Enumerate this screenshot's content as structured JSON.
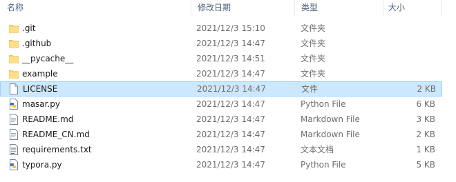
{
  "columns": {
    "name": "名称",
    "date": "修改日期",
    "type": "类型",
    "size": "大小"
  },
  "files": [
    {
      "name": ".git",
      "date": "2021/12/3 15:10",
      "type": "文件夹",
      "size": "",
      "icon": "folder-icon"
    },
    {
      "name": ".github",
      "date": "2021/12/3 14:47",
      "type": "文件夹",
      "size": "",
      "icon": "folder-icon"
    },
    {
      "name": "__pycache__",
      "date": "2021/12/3 14:51",
      "type": "文件夹",
      "size": "",
      "icon": "folder-icon"
    },
    {
      "name": "example",
      "date": "2021/12/3 14:47",
      "type": "文件夹",
      "size": "",
      "icon": "folder-icon"
    },
    {
      "name": "LICENSE",
      "date": "2021/12/3 14:47",
      "type": "文件",
      "size": "2 KB",
      "icon": "blank-file-icon"
    },
    {
      "name": "masar.py",
      "date": "2021/12/3 14:47",
      "type": "Python File",
      "size": "6 KB",
      "icon": "python-file-icon"
    },
    {
      "name": "README.md",
      "date": "2021/12/3 14:47",
      "type": "Markdown File",
      "size": "3 KB",
      "icon": "markdown-file-icon"
    },
    {
      "name": "README_CN.md",
      "date": "2021/12/3 14:47",
      "type": "Markdown File",
      "size": "2 KB",
      "icon": "markdown-file-icon"
    },
    {
      "name": "requirements.txt",
      "date": "2021/12/3 14:47",
      "type": "文本文档",
      "size": "1 KB",
      "icon": "text-file-icon"
    },
    {
      "name": "typora.py",
      "date": "2021/12/3 14:47",
      "type": "Python File",
      "size": "5 KB",
      "icon": "python-file-icon"
    }
  ],
  "selected_row": "LICENSE",
  "colors": {
    "selection": "#cce8ff",
    "selection_border": "#99d1ff",
    "folder": "#ffd86e",
    "header_text": "#4c607a"
  }
}
